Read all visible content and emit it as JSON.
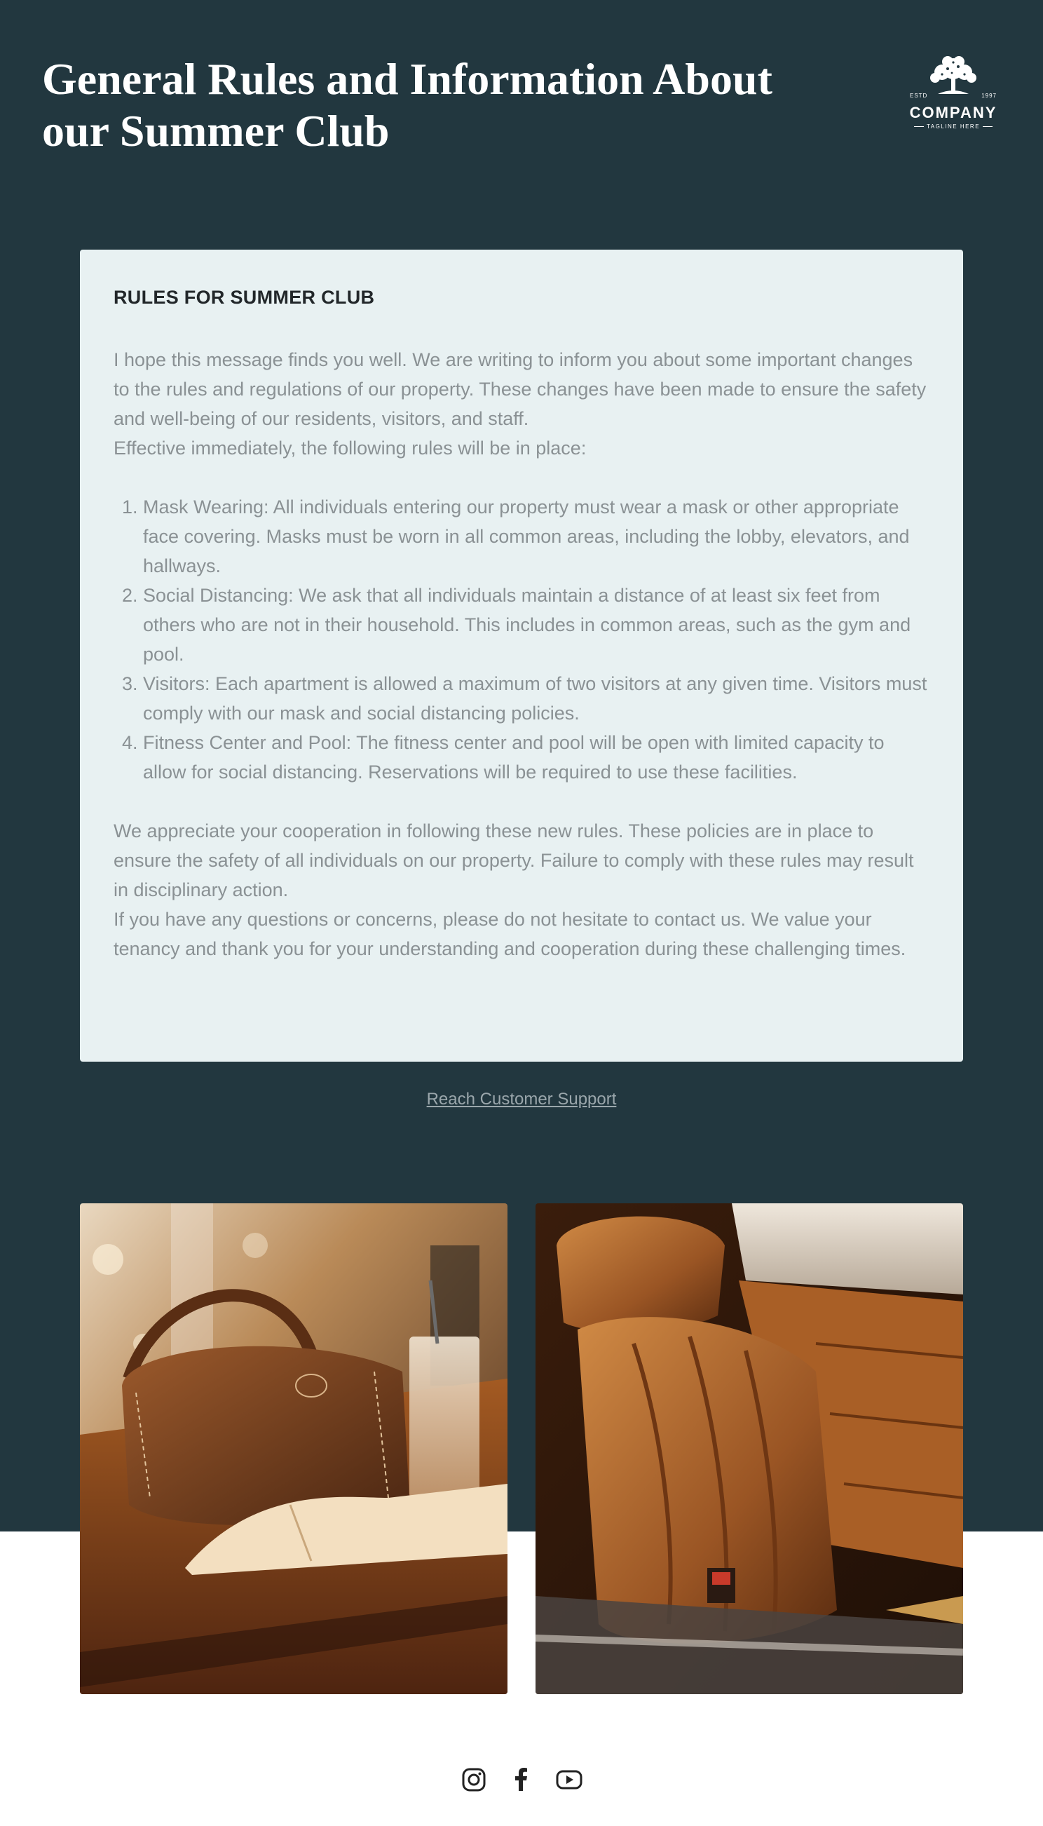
{
  "header": {
    "title": "General Rules and Information About our Summer Club",
    "logo": {
      "icon": "tree-icon",
      "estd": "ESTD",
      "year": "1997",
      "name": "COMPANY",
      "tagline": "TAGLINE HERE"
    }
  },
  "card": {
    "heading": "RULES FOR SUMMER CLUB",
    "intro": "I hope this message finds you well. We are writing to inform you about some important changes to the rules and regulations of our property. These changes have been made to ensure the safety and well-being of our residents, visitors, and staff.",
    "intro2": "Effective immediately, the following rules will be in place:",
    "rules": [
      "Mask Wearing: All individuals entering our property must wear a mask or other appropriate face covering. Masks must be worn in all common areas, including the lobby, elevators, and hallways.",
      "Social Distancing: We ask that all individuals maintain a distance of at least six feet from others who are not in their household. This includes in common areas, such as the gym and pool.",
      "Visitors: Each apartment is allowed a maximum of two visitors at any given time. Visitors must comply with our mask and social distancing policies.",
      "Fitness Center and Pool: The fitness center and pool will be open with limited capacity to allow for social distancing. Reservations will be required to use these facilities."
    ],
    "closing": "We appreciate your cooperation in following these new rules. These policies are in place to ensure the safety of all individuals on our property. Failure to comply with these rules may result in disciplinary action.",
    "closing2": "If you have any questions or concerns, please do not hesitate to contact us. We value your tenancy and thank you for your understanding and cooperation during these challenging times."
  },
  "support_link": "Reach Customer Support",
  "photos": [
    {
      "icon": "leather-bag-photo"
    },
    {
      "icon": "car-seat-photo"
    }
  ],
  "socials": [
    {
      "icon": "instagram-icon"
    },
    {
      "icon": "facebook-icon"
    },
    {
      "icon": "youtube-icon"
    }
  ],
  "colors": {
    "background_dark": "#22373f",
    "card_background": "#e8f1f2",
    "body_text": "#8a9194",
    "heading_text": "#22272a",
    "link_text": "#9aa6ab"
  }
}
